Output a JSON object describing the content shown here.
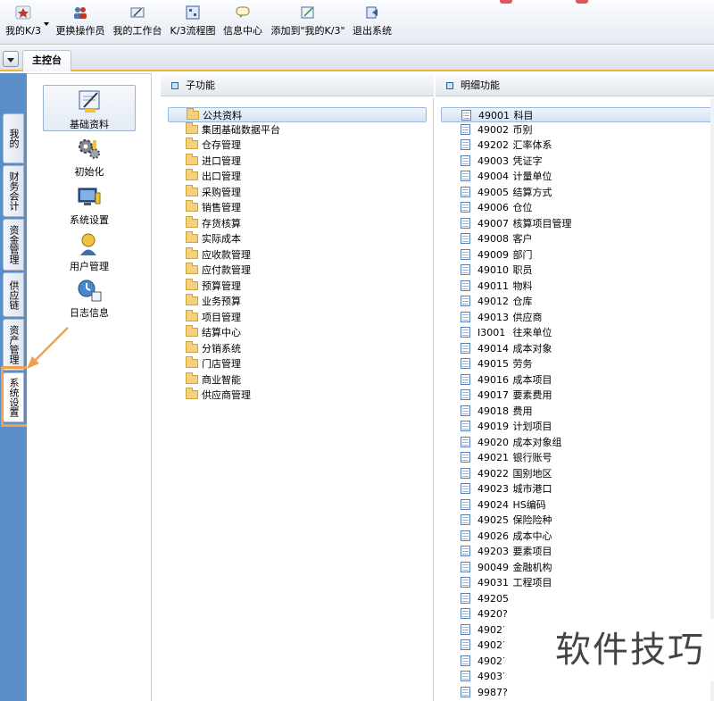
{
  "toolbar": {
    "buttons": [
      {
        "label": "我的K/3",
        "icon": "star-icon"
      },
      {
        "label": "更换操作员",
        "icon": "users-icon"
      },
      {
        "label": "我的工作台",
        "icon": "desk-icon"
      },
      {
        "label": "K/3流程图",
        "icon": "flowchart-icon"
      },
      {
        "label": "信息中心",
        "icon": "message-icon"
      },
      {
        "label": "添加到\"我的K/3\"",
        "icon": "add-favorite-icon"
      },
      {
        "label": "退出系统",
        "icon": "exit-icon"
      }
    ]
  },
  "tabs": {
    "main_label": "主控台"
  },
  "vertical_tabs": [
    {
      "label": "我的K/3"
    },
    {
      "label": "财务会计"
    },
    {
      "label": "资金管理"
    },
    {
      "label": "供应链"
    },
    {
      "label": "资产管理"
    },
    {
      "label": "系统设置"
    }
  ],
  "icon_panel": [
    {
      "label": "基础资料",
      "icon": "basic-data-icon"
    },
    {
      "label": "初始化",
      "icon": "gears-icon"
    },
    {
      "label": "系统设置",
      "icon": "system-settings-icon"
    },
    {
      "label": "用户管理",
      "icon": "user-icon"
    },
    {
      "label": "日志信息",
      "icon": "clock-log-icon"
    }
  ],
  "sub_function": {
    "header": "子功能",
    "items": [
      "公共资料",
      "集团基础数据平台",
      "仓存管理",
      "进口管理",
      "出口管理",
      "采购管理",
      "销售管理",
      "存货核算",
      "实际成本",
      "应收款管理",
      "应付款管理",
      "预算管理",
      "业务预算",
      "项目管理",
      "结算中心",
      "分销系统",
      "门店管理",
      "商业智能",
      "供应商管理"
    ]
  },
  "detail_function": {
    "header": "明细功能",
    "items": [
      {
        "code": "49001",
        "name": "科目"
      },
      {
        "code": "49002",
        "name": "币别"
      },
      {
        "code": "49202",
        "name": "汇率体系"
      },
      {
        "code": "49003",
        "name": "凭证字"
      },
      {
        "code": "49004",
        "name": "计量单位"
      },
      {
        "code": "49005",
        "name": "结算方式"
      },
      {
        "code": "49006",
        "name": "仓位"
      },
      {
        "code": "49007",
        "name": "核算项目管理"
      },
      {
        "code": "49008",
        "name": "客户"
      },
      {
        "code": "49009",
        "name": "部门"
      },
      {
        "code": "49010",
        "name": "职员"
      },
      {
        "code": "49011",
        "name": "物料"
      },
      {
        "code": "49012",
        "name": "仓库"
      },
      {
        "code": "49013",
        "name": "供应商"
      },
      {
        "code": "I3001",
        "name": "往来单位"
      },
      {
        "code": "49014",
        "name": "成本对象"
      },
      {
        "code": "49015",
        "name": "劳务"
      },
      {
        "code": "49016",
        "name": "成本项目"
      },
      {
        "code": "49017",
        "name": "要素费用"
      },
      {
        "code": "49018",
        "name": "费用"
      },
      {
        "code": "49019",
        "name": "计划项目"
      },
      {
        "code": "49020",
        "name": "成本对象组"
      },
      {
        "code": "49021",
        "name": "银行账号"
      },
      {
        "code": "49022",
        "name": "国别地区"
      },
      {
        "code": "49023",
        "name": "城市港口"
      },
      {
        "code": "49024",
        "name": "HS编码"
      },
      {
        "code": "49025",
        "name": "保险险种"
      },
      {
        "code": "49026",
        "name": "成本中心"
      },
      {
        "code": "49203",
        "name": "要素项目"
      },
      {
        "code": "90049",
        "name": "金融机构"
      },
      {
        "code": "49031",
        "name": "工程项目"
      },
      {
        "code": "49205",
        "name": ""
      },
      {
        "code": "4920?",
        "name": ""
      },
      {
        "code": "4902?",
        "name": ""
      },
      {
        "code": "4902?",
        "name": ""
      },
      {
        "code": "4902?",
        "name": ""
      },
      {
        "code": "4903?",
        "name": ""
      },
      {
        "code": "9987?",
        "name": ""
      }
    ]
  },
  "watermark": "软件技巧"
}
